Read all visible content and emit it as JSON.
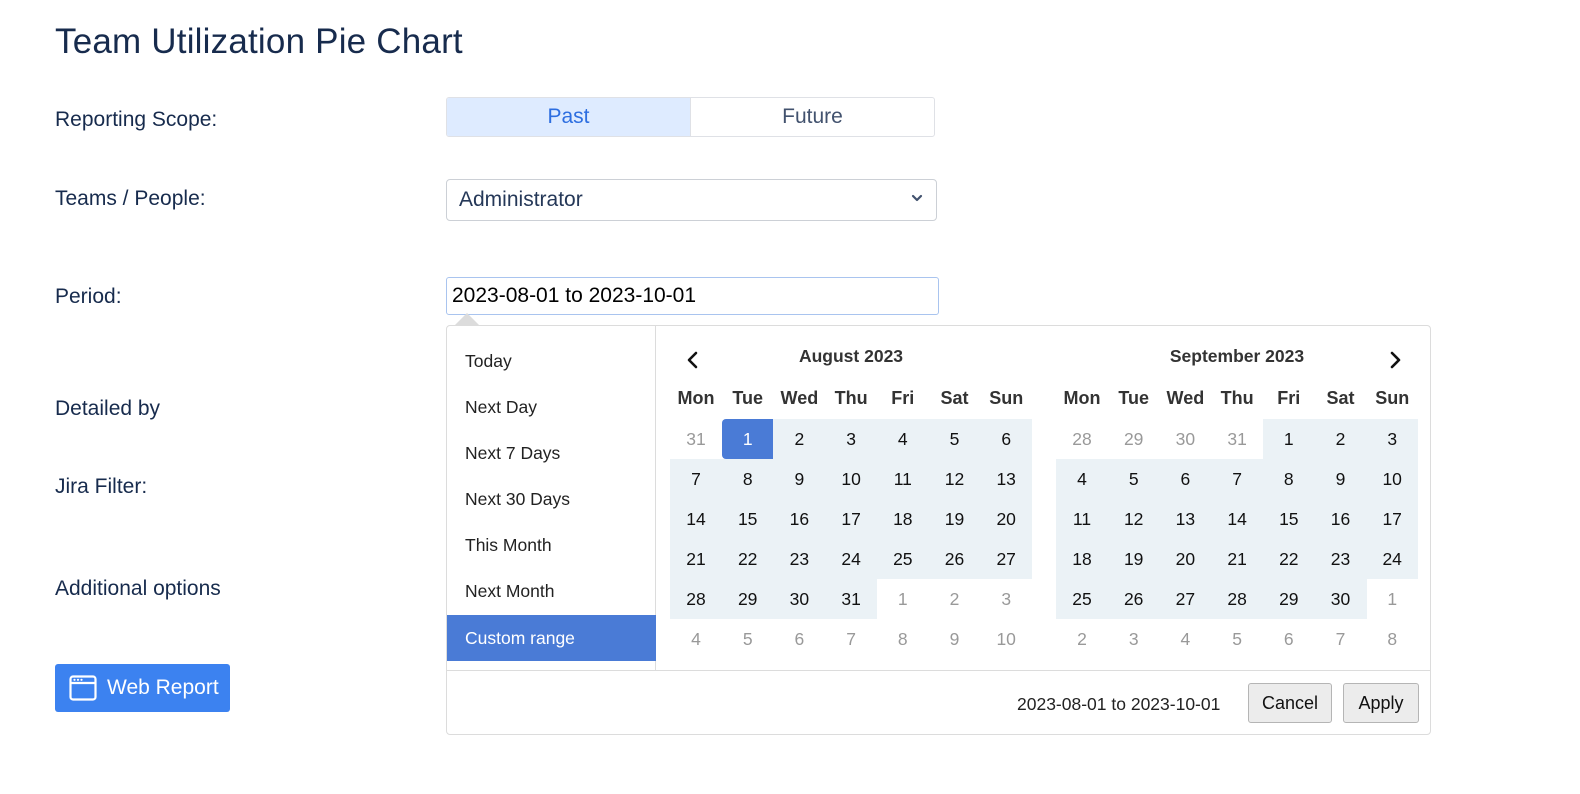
{
  "page": {
    "title": "Team Utilization Pie Chart"
  },
  "form": {
    "reporting_scope_label": "Reporting Scope:",
    "scope_options": [
      "Past",
      "Future"
    ],
    "scope_selected": "Past",
    "teams_label": "Teams / People:",
    "teams_value": "Administrator",
    "period_label": "Period:",
    "period_value": "2023-08-01 to 2023-10-01",
    "detailed_by_label": "Detailed by",
    "jira_filter_label": "Jira Filter:",
    "additional_options_label": "Additional options",
    "web_report_label": "Web Report"
  },
  "picker": {
    "ranges": [
      "Today",
      "Next Day",
      "Next 7 Days",
      "Next 30 Days",
      "This Month",
      "Next Month",
      "Custom range"
    ],
    "active_range": "Custom range",
    "weekdays": [
      "Mon",
      "Tue",
      "Wed",
      "Thu",
      "Fri",
      "Sat",
      "Sun"
    ],
    "left_month": "August 2023",
    "right_month": "September 2023",
    "left_days": [
      [
        "31",
        "1",
        "2",
        "3",
        "4",
        "5",
        "6"
      ],
      [
        "7",
        "8",
        "9",
        "10",
        "11",
        "12",
        "13"
      ],
      [
        "14",
        "15",
        "16",
        "17",
        "18",
        "19",
        "20"
      ],
      [
        "21",
        "22",
        "23",
        "24",
        "25",
        "26",
        "27"
      ],
      [
        "28",
        "29",
        "30",
        "31",
        "1",
        "2",
        "3"
      ],
      [
        "4",
        "5",
        "6",
        "7",
        "8",
        "9",
        "10"
      ]
    ],
    "right_days": [
      [
        "28",
        "29",
        "30",
        "31",
        "1",
        "2",
        "3"
      ],
      [
        "4",
        "5",
        "6",
        "7",
        "8",
        "9",
        "10"
      ],
      [
        "11",
        "12",
        "13",
        "14",
        "15",
        "16",
        "17"
      ],
      [
        "18",
        "19",
        "20",
        "21",
        "22",
        "23",
        "24"
      ],
      [
        "25",
        "26",
        "27",
        "28",
        "29",
        "30",
        "1"
      ],
      [
        "2",
        "3",
        "4",
        "5",
        "6",
        "7",
        "8"
      ]
    ],
    "selected_range_text": "2023-08-01 to 2023-10-01",
    "cancel_label": "Cancel",
    "apply_label": "Apply"
  },
  "colors": {
    "accent": "#4a7bd6",
    "range_bg": "#ebf2f6",
    "button_blue": "#3c82f0",
    "scope_active_bg": "#deebff"
  }
}
